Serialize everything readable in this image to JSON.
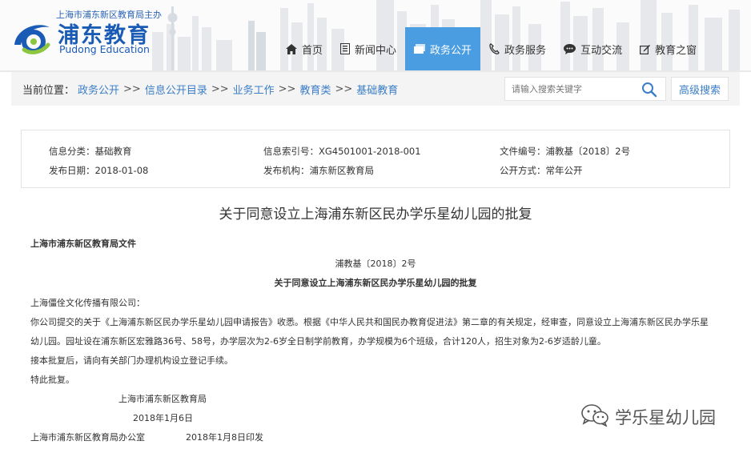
{
  "header": {
    "logo_top": "上海市浦东新区教育局主办",
    "logo_cn": "浦东教育",
    "logo_en": "Pudong Education"
  },
  "nav": {
    "items": [
      {
        "label": "首页",
        "icon": "home-icon"
      },
      {
        "label": "新闻中心",
        "icon": "document-icon"
      },
      {
        "label": "政务公开",
        "icon": "folder-icon",
        "active": true
      },
      {
        "label": "政务服务",
        "icon": "phone-icon"
      },
      {
        "label": "互动交流",
        "icon": "chat-bubble-icon"
      },
      {
        "label": "教育之窗",
        "icon": "edit-icon"
      }
    ]
  },
  "breadcrumb": {
    "label": "当前位置：",
    "items": [
      "政务公开",
      "信息公开目录",
      "业务工作",
      "教育类",
      "基础教育"
    ],
    "separator": ">>"
  },
  "search": {
    "placeholder": "请输入搜索关键字",
    "advanced_label": "高级搜索"
  },
  "info": {
    "category_label": "信息分类：",
    "category": "基础教育",
    "index_label": "信息索引号：",
    "index": "XG4501001-2018-001",
    "docno_label": "文件编号：",
    "docno": "浦教基〔2018〕2号",
    "date_label": "发布日期：",
    "date": "2018-01-08",
    "org_label": "发布机构：",
    "org": "浦东新区教育局",
    "mode_label": "公开方式：",
    "mode": "常年公开"
  },
  "article": {
    "title": "关于同意设立上海浦东新区民办学乐星幼儿园的批复",
    "doc_header": "上海市浦东新区教育局文件",
    "doc_no": "浦教基〔2018〕2号",
    "doc_title": "关于同意设立上海浦东新区民办学乐星幼儿园的批复",
    "recipient": "上海僵佺文化传播有限公司：",
    "body_1": "你公司提交的关于《上海浦东新区民办学乐星幼儿园申请报告》收悉。根据《中华人民共和国民办教育促进法》第二章的有关规定，经审查，同意设立上海浦东新区民办学乐星",
    "body_2": "幼儿园。园址设在浦东新区宏雅路36号、58号，办学层次为2-6岁全日制学前教育，办学规模为6个班级，合计120人，招生对象为2-6岁适龄儿童。",
    "body_3": "接本批复后，请向有关部门办理机构设立登记手续。",
    "body_4": "特此批复。",
    "sign_org": "上海市浦东新区教育局",
    "sign_date": "2018年1月6日",
    "footer_office": "上海市浦东新区教育局办公室",
    "footer_date": "2018年1月8日印发"
  },
  "watermark": {
    "text": "学乐星幼儿园",
    "icon": "wechat-icon"
  },
  "colors": {
    "brand": "#1a5bb5",
    "nav_active": "#4a9de0",
    "link": "#3b7ec7"
  }
}
